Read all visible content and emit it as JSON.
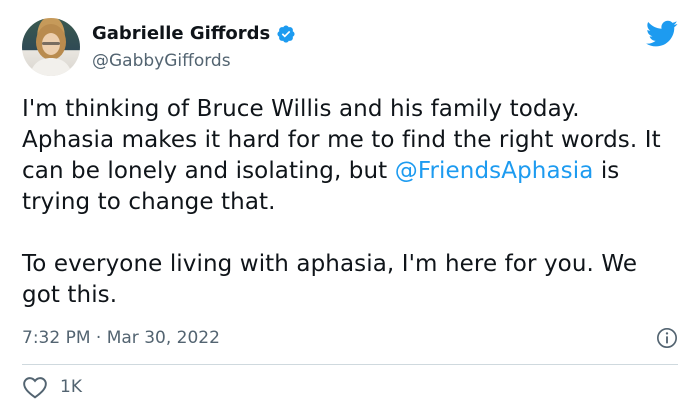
{
  "author": {
    "name": "Gabrielle Giffords",
    "handle": "@GabbyGiffords",
    "avatar_icon": "profile-photo",
    "verified_icon": "verified-badge-icon"
  },
  "tweet": {
    "paragraph1_before": "I'm thinking of Bruce Willis and his family today. Aphasia makes it hard for me to find the right words. It can be lonely and isolating, but ",
    "mention": "@FriendsAphasia",
    "paragraph1_after": " is trying to change that.",
    "paragraph2": "To everyone living with aphasia, I'm here for you. We got this.",
    "timestamp": "7:32 PM · Mar 30, 2022"
  },
  "stats": {
    "likes": "1K"
  },
  "colors": {
    "accent": "#1d9bf0",
    "text": "#0f1419",
    "muted": "#536471",
    "divider": "#cfd9de"
  }
}
